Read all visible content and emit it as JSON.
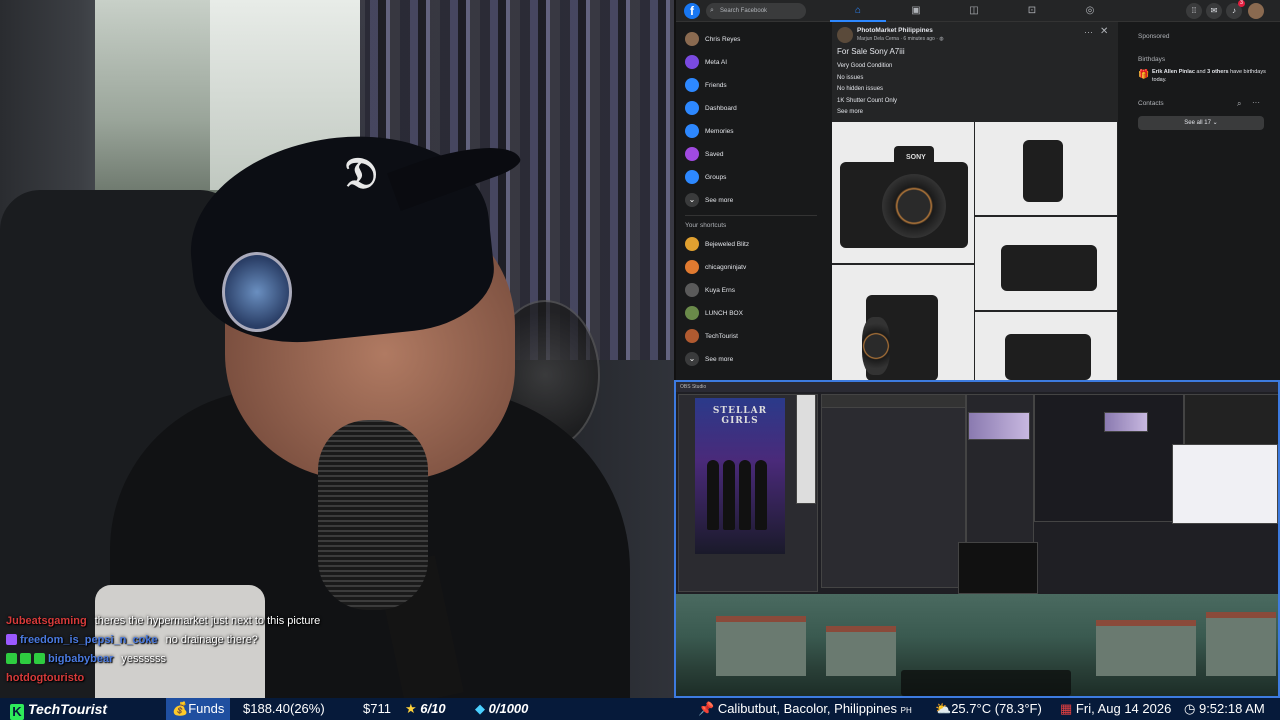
{
  "chat": [
    {
      "user": "Jubeatsgaming",
      "user_color": "#d63a3a",
      "message": "theres the hypermarket just next to this picture",
      "badges": []
    },
    {
      "user": "freedom_is_pepsi_n_coke",
      "user_color": "#4a7ae0",
      "message": "no drainage there?",
      "badges": [
        "#9b59ff"
      ]
    },
    {
      "user": "bigbabybear",
      "user_color": "#4a7ae0",
      "message": "yessssss",
      "badges": [
        "#2ecc40",
        "#2ecc40",
        "#2ecc40"
      ]
    },
    {
      "user": "hotdogtouristo",
      "user_color": "#d63a3a",
      "message": "",
      "badges": []
    }
  ],
  "facebook": {
    "search_placeholder": "Search Facebook",
    "notification_count": "3",
    "left_menu": [
      {
        "label": "Chris Reyes",
        "icon": "avatar-icon",
        "color": "#8a6a50"
      },
      {
        "label": "Meta AI",
        "icon": "meta-ai-icon",
        "color": "#7a4ae0"
      },
      {
        "label": "Friends",
        "icon": "friends-icon",
        "color": "#2d88ff"
      },
      {
        "label": "Dashboard",
        "icon": "dashboard-icon",
        "color": "#2d88ff"
      },
      {
        "label": "Memories",
        "icon": "memories-icon",
        "color": "#2d88ff"
      },
      {
        "label": "Saved",
        "icon": "saved-icon",
        "color": "#a04ae0"
      },
      {
        "label": "Groups",
        "icon": "groups-icon",
        "color": "#2d88ff"
      },
      {
        "label": "See more",
        "icon": "chevron-down-icon",
        "color": "#3a3b3c"
      }
    ],
    "shortcuts_title": "Your shortcuts",
    "shortcuts": [
      {
        "label": "Bejeweled Blitz",
        "icon": "bejeweled-icon",
        "color": "#e0a030"
      },
      {
        "label": "chicagoninjatv",
        "icon": "c-icon",
        "color": "#e07a30"
      },
      {
        "label": "Kuya Erns",
        "icon": "kuya-icon",
        "color": "#5a5a5a"
      },
      {
        "label": "LUNCH BOX",
        "icon": "lunchbox-icon",
        "color": "#6a8a4a"
      },
      {
        "label": "TechTourist",
        "icon": "techtourist-icon",
        "color": "#b05a30"
      },
      {
        "label": "See more",
        "icon": "chevron-down-icon",
        "color": "#3a3b3c"
      }
    ],
    "post": {
      "group": "PhotoMarket Philippines",
      "meta": "Marjun Dela Cerna · 6 minutes ago · ",
      "title": "For Sale Sony A7iii",
      "lines": [
        "Very Good Condition",
        "No issues",
        "No hidden issues",
        "1K Shutter Count Only"
      ],
      "see_more": "See more",
      "camera_brand": "SONY"
    },
    "right": {
      "sponsored": "Sponsored",
      "birthdays_title": "Birthdays",
      "birthday_name": "Erik Allen Pinlac",
      "birthday_and": " and ",
      "birthday_others": "3 others",
      "birthday_rest": " have birthdays today.",
      "contacts_title": "Contacts",
      "see_all": "See all 17"
    }
  },
  "desktop": {
    "tiktok_title": "STELLAR GIRLS",
    "window_title": "OBS Studio"
  },
  "ticker": {
    "channel": "TechTourist",
    "funds_label": "Funds",
    "funds_value": "$188.40(26%)",
    "amount": "$711",
    "stars": "6/10",
    "gems": "0/1000",
    "location": "Calibutbut, Bacolor, Philippines",
    "country": "PH",
    "weather": "25.7°C (78.3°F)",
    "date": "Fri, Aug 14 2026",
    "time": "9:52:18 AM"
  }
}
